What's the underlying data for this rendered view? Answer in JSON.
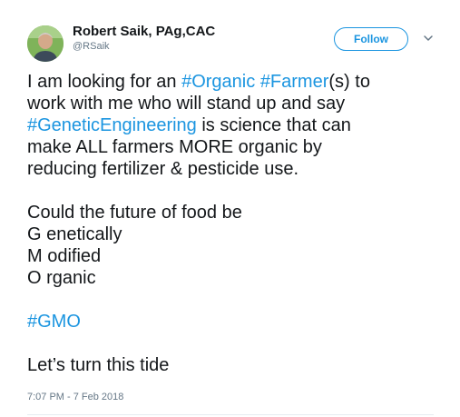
{
  "author": {
    "name": "Robert Saik, PAg,CAC",
    "handle": "@RSaik"
  },
  "follow_button": {
    "label": "Follow"
  },
  "tweet": {
    "line1_pre": "I am looking for an ",
    "tag_organic": "#Organic",
    "line1_space": " ",
    "tag_farmer": "#Farmer",
    "line1_post": "(s) to",
    "line2": "work with me who will stand up and say",
    "tag_genetic": "#GeneticEngineering",
    "line3_post": " is science that can",
    "line4": "make ALL farmers MORE organic by",
    "line5": "reducing fertilizer & pesticide use.",
    "line6": "Could the future of food be",
    "line7": "G enetically",
    "line8": "M odified",
    "line9": "O rganic",
    "tag_gmo": "#GMO",
    "line10": "Let’s turn this tide"
  },
  "timestamp": "7:07 PM - 7 Feb 2018",
  "icons": {
    "avatar": "profile-photo",
    "more": "chevron-down-icon"
  },
  "colors": {
    "link": "#1b95e0",
    "text": "#14171a",
    "muted": "#657786"
  }
}
